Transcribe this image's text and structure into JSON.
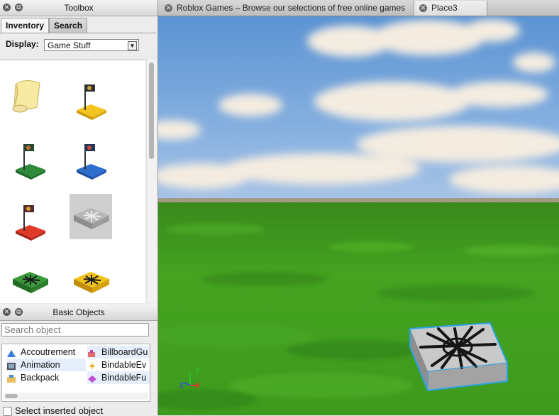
{
  "toolbox": {
    "title": "Toolbox",
    "tabs": [
      {
        "label": "Inventory"
      },
      {
        "label": "Search"
      }
    ],
    "display_label": "Display:",
    "display_value": "Game Stuff"
  },
  "basic_objects": {
    "title": "Basic Objects",
    "search_placeholder": "Search object",
    "items": [
      {
        "label": "Accoutrement",
        "icon": "accoutrement-icon"
      },
      {
        "label": "BillboardGu",
        "icon": "billboard-gui-icon"
      },
      {
        "label": "Animation",
        "icon": "animation-icon"
      },
      {
        "label": "BindableEv",
        "icon": "bindable-event-icon"
      },
      {
        "label": "Backpack",
        "icon": "backpack-icon"
      },
      {
        "label": "BindableFu",
        "icon": "bindable-function-icon"
      }
    ],
    "checkbox_label": "Select inserted object"
  },
  "doc_tabs": [
    {
      "label": "Roblox Games – Browse our selections of free online games"
    },
    {
      "label": "Place3"
    }
  ],
  "viewport": {
    "axis_labels": {
      "y": "Y",
      "z": "Z",
      "x": "X"
    }
  },
  "colors": {
    "selection": "#29a3e8",
    "sky": "#6fa2d8",
    "grass": "#3e9a1f"
  }
}
